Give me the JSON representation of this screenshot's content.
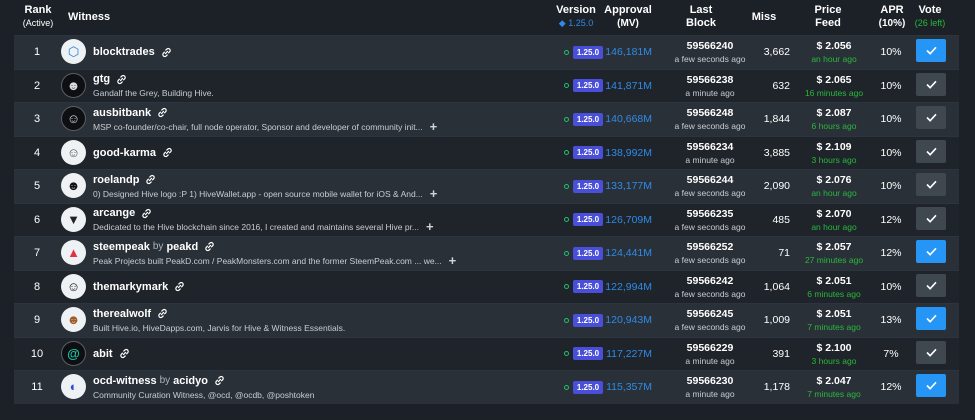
{
  "header": {
    "rank": "Rank",
    "rank_sub": "(Active)",
    "witness": "Witness",
    "version": "Version",
    "version_sub": "1.25.0",
    "approval": "Approval",
    "approval_sub": "(MV)",
    "last_block": "Last",
    "last_block_sub": "Block",
    "miss": "Miss",
    "price": "Price",
    "price_sub": "Feed",
    "apr": "APR",
    "apr_sub": "(10%)",
    "vote": "Vote",
    "vote_sub": "(26 left)"
  },
  "colors": {
    "accent": "#2596f5",
    "green": "#28b93c",
    "badge": "#4a4fd9",
    "approval": "#2e8be8"
  },
  "rows": [
    {
      "rank": "1",
      "name": "blocktrades",
      "by": "",
      "by_name": "",
      "desc": "",
      "plus": false,
      "version": "1.25.0",
      "approval": "146,181M",
      "block": "59566240",
      "block_time": "a few seconds ago",
      "miss": "3,662",
      "price": "$ 2.056",
      "price_time": "an hour ago",
      "apr": "10%",
      "voted": true,
      "avatar": "hive-logo-icon"
    },
    {
      "rank": "2",
      "name": "gtg",
      "by": "",
      "by_name": "",
      "desc": "Gandalf the Grey, Building Hive.",
      "plus": false,
      "version": "1.25.0",
      "approval": "141,871M",
      "block": "59566238",
      "block_time": "a minute ago",
      "miss": "632",
      "price": "$ 2.065",
      "price_time": "16 minutes ago",
      "apr": "10%",
      "voted": false,
      "avatar": "wizard-icon"
    },
    {
      "rank": "3",
      "name": "ausbitbank",
      "by": "",
      "by_name": "",
      "desc": "MSP co-founder/co-chair, full node operator, Sponsor and developer of community init...",
      "plus": true,
      "version": "1.25.0",
      "approval": "140,668M",
      "block": "59566248",
      "block_time": "a few seconds ago",
      "miss": "1,844",
      "price": "$ 2.087",
      "price_time": "6 hours ago",
      "apr": "10%",
      "voted": false,
      "avatar": "robot-icon"
    },
    {
      "rank": "4",
      "name": "good-karma",
      "by": "",
      "by_name": "",
      "desc": "",
      "plus": false,
      "version": "1.25.0",
      "approval": "138,992M",
      "block": "59566234",
      "block_time": "a minute ago",
      "miss": "3,885",
      "price": "$ 2.109",
      "price_time": "3 hours ago",
      "apr": "10%",
      "voted": false,
      "avatar": "person-icon"
    },
    {
      "rank": "5",
      "name": "roelandp",
      "by": "",
      "by_name": "",
      "desc": "0) Designed Hive logo :P 1) HiveWallet.app - open source mobile wallet for iOS & And...",
      "plus": true,
      "version": "1.25.0",
      "approval": "133,177M",
      "block": "59566244",
      "block_time": "a few seconds ago",
      "miss": "2,090",
      "price": "$ 2.076",
      "price_time": "an hour ago",
      "apr": "10%",
      "voted": false,
      "avatar": "face-icon"
    },
    {
      "rank": "6",
      "name": "arcange",
      "by": "",
      "by_name": "",
      "desc": "Dedicated to the Hive blockchain since 2016, I created and maintains several Hive pr...",
      "plus": true,
      "version": "1.25.0",
      "approval": "126,709M",
      "block": "59566235",
      "block_time": "a few seconds ago",
      "miss": "485",
      "price": "$ 2.070",
      "price_time": "an hour ago",
      "apr": "12%",
      "voted": false,
      "avatar": "assassin-icon"
    },
    {
      "rank": "7",
      "name": "steempeak",
      "by": "by",
      "by_name": "peakd",
      "desc": "Peak Projects built PeakD.com / PeakMonsters.com and the former SteemPeak.com ... we...",
      "plus": true,
      "version": "1.25.0",
      "approval": "124,441M",
      "block": "59566252",
      "block_time": "a few seconds ago",
      "miss": "71",
      "price": "$ 2.057",
      "price_time": "27 minutes ago",
      "apr": "12%",
      "voted": true,
      "avatar": "peak-icon"
    },
    {
      "rank": "8",
      "name": "themarkymark",
      "by": "",
      "by_name": "",
      "desc": "",
      "plus": false,
      "version": "1.25.0",
      "approval": "122,994M",
      "block": "59566242",
      "block_time": "a few seconds ago",
      "miss": "1,064",
      "price": "$ 2.051",
      "price_time": "6 minutes ago",
      "apr": "10%",
      "voted": false,
      "avatar": "cartoon-icon"
    },
    {
      "rank": "9",
      "name": "therealwolf",
      "by": "",
      "by_name": "",
      "desc": "Built Hive.io, HiveDapps.com, Jarvis for Hive & Witness Essentials.",
      "plus": false,
      "version": "1.25.0",
      "approval": "120,943M",
      "block": "59566245",
      "block_time": "a few seconds ago",
      "miss": "1,009",
      "price": "$ 2.051",
      "price_time": "7 minutes ago",
      "apr": "13%",
      "voted": true,
      "avatar": "wolf-icon"
    },
    {
      "rank": "10",
      "name": "abit",
      "by": "",
      "by_name": "",
      "desc": "",
      "plus": false,
      "version": "1.25.0",
      "approval": "117,227M",
      "block": "59566229",
      "block_time": "a minute ago",
      "miss": "391",
      "price": "$ 2.100",
      "price_time": "3 hours ago",
      "apr": "7%",
      "voted": false,
      "avatar": "at-sign-icon"
    },
    {
      "rank": "11",
      "name": "ocd-witness",
      "by": "by",
      "by_name": "acidyo",
      "desc": "Community Curation Witness, @ocd, @ocdb, @poshtoken",
      "plus": false,
      "version": "1.25.0",
      "approval": "115,357M",
      "block": "59566230",
      "block_time": "a minute ago",
      "miss": "1,178",
      "price": "$ 2.047",
      "price_time": "7 minutes ago",
      "apr": "12%",
      "voted": true,
      "avatar": "ocd-logo-icon"
    }
  ]
}
